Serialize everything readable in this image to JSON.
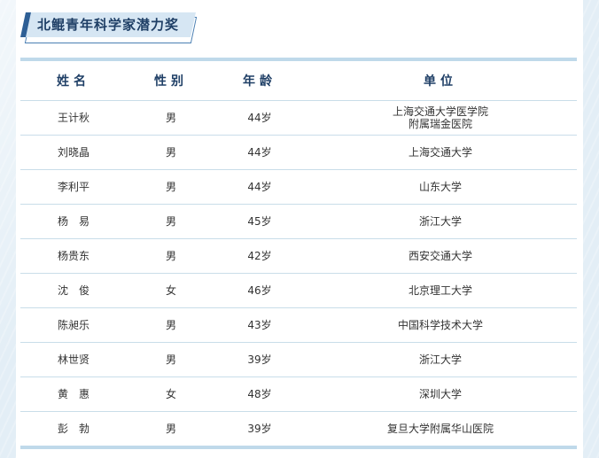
{
  "section_title": "北鲲青年科学家潜力奖",
  "table": {
    "headers": [
      "姓名",
      "性别",
      "年龄",
      "单位"
    ],
    "rows": [
      {
        "name": "王计秋",
        "gender": "男",
        "age": "44岁",
        "unit": [
          "上海交通大学医学院",
          "附属瑞金医院"
        ]
      },
      {
        "name": "刘晓晶",
        "gender": "男",
        "age": "44岁",
        "unit": [
          "上海交通大学"
        ]
      },
      {
        "name": "李利平",
        "gender": "男",
        "age": "44岁",
        "unit": [
          "山东大学"
        ]
      },
      {
        "name": "杨　易",
        "gender": "男",
        "age": "45岁",
        "unit": [
          "浙江大学"
        ]
      },
      {
        "name": "杨贵东",
        "gender": "男",
        "age": "42岁",
        "unit": [
          "西安交通大学"
        ]
      },
      {
        "name": "沈　俊",
        "gender": "女",
        "age": "46岁",
        "unit": [
          "北京理工大学"
        ]
      },
      {
        "name": "陈昶乐",
        "gender": "男",
        "age": "43岁",
        "unit": [
          "中国科学技术大学"
        ]
      },
      {
        "name": "林世贤",
        "gender": "男",
        "age": "39岁",
        "unit": [
          "浙江大学"
        ]
      },
      {
        "name": "黄　惠",
        "gender": "女",
        "age": "48岁",
        "unit": [
          "深圳大学"
        ]
      },
      {
        "name": "彭　勃",
        "gender": "男",
        "age": "39岁",
        "unit": [
          "复旦大学附属华山医院"
        ]
      }
    ]
  }
}
